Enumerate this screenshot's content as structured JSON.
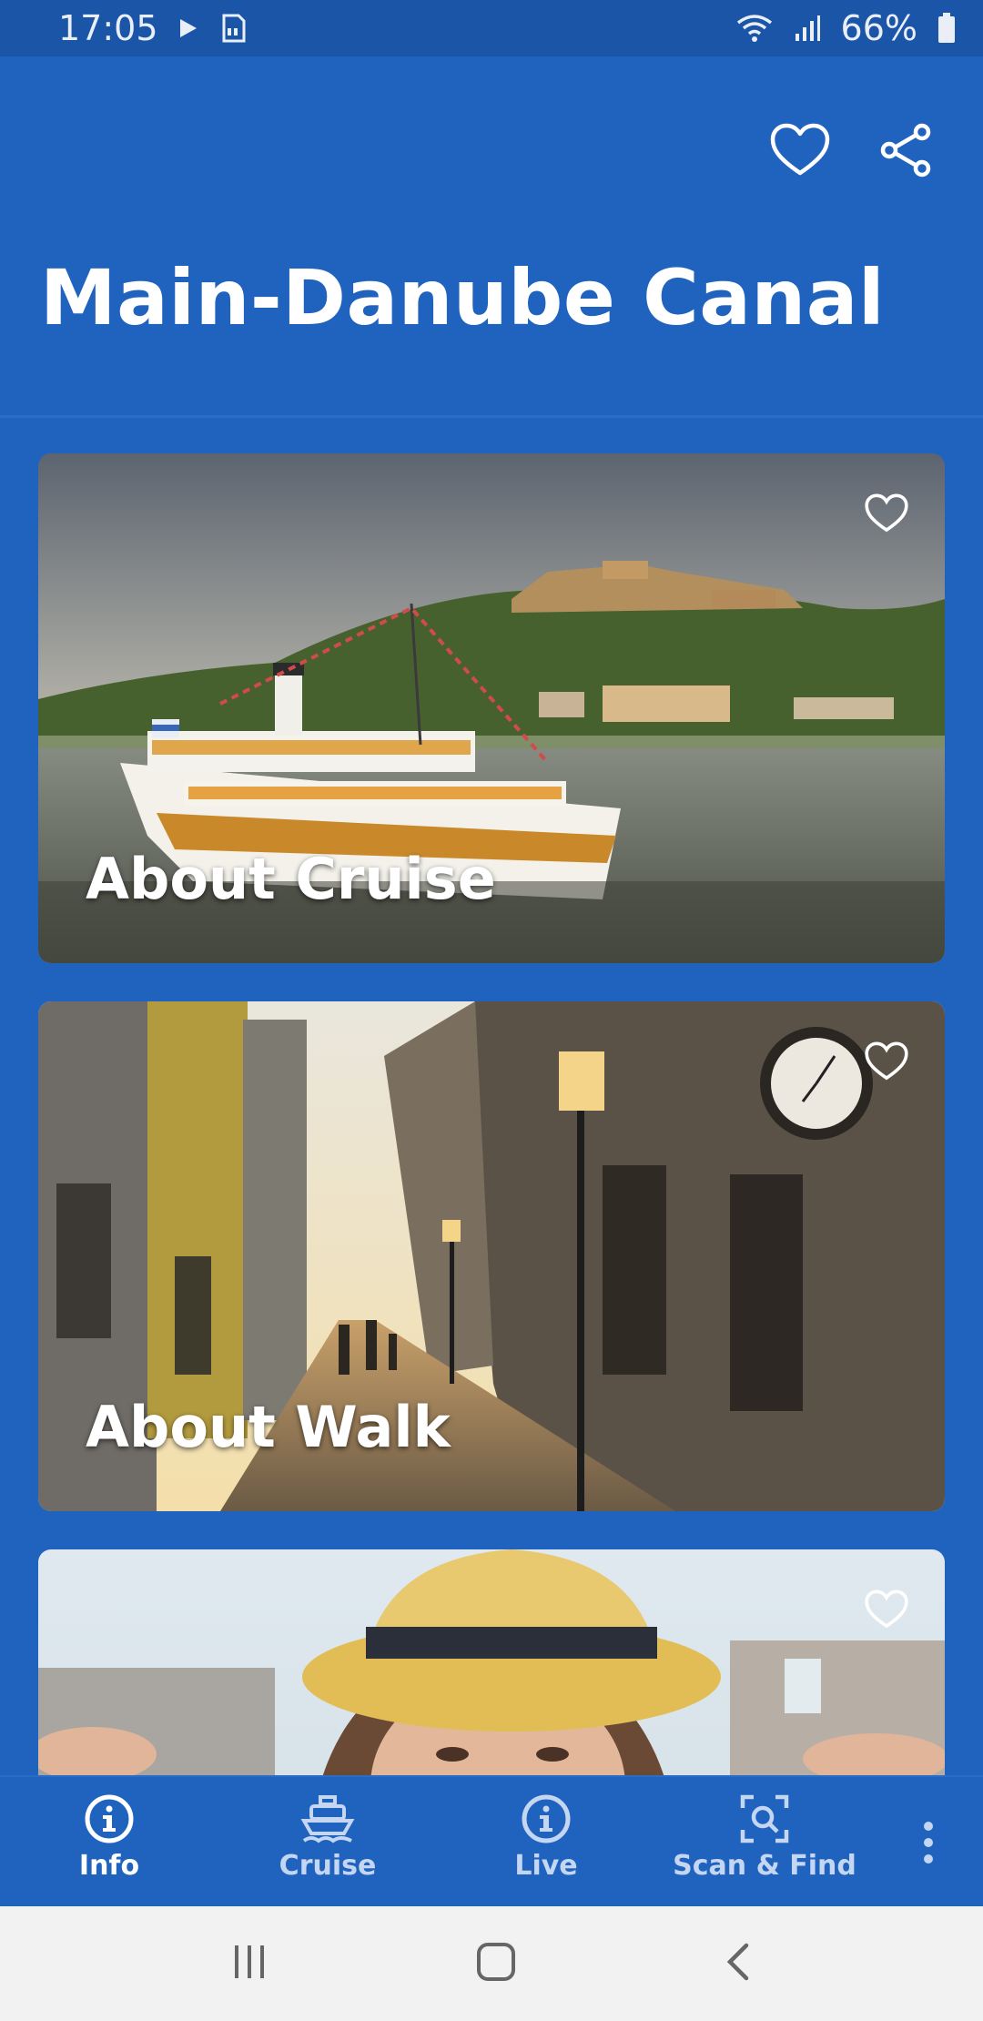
{
  "status_bar": {
    "time": "17:05",
    "battery": "66%",
    "icons": [
      "play-icon",
      "sd-card-icon",
      "wifi-icon",
      "signal-icon",
      "battery-icon"
    ]
  },
  "app_bar": {
    "title": "Main-Danube Canal",
    "actions": [
      "heart-outline-icon",
      "share-icon"
    ]
  },
  "cards": [
    {
      "title": "About Cruise",
      "image": "river-cruise-ship-and-castle"
    },
    {
      "title": "About Walk",
      "image": "old-town-street-at-sunset"
    },
    {
      "title": "",
      "image": "woman-in-straw-hat"
    }
  ],
  "bottom_nav": {
    "items": [
      {
        "label": "Info",
        "icon": "info-icon",
        "active": true
      },
      {
        "label": "Cruise",
        "icon": "ship-icon",
        "active": false
      },
      {
        "label": "Live",
        "icon": "info-icon",
        "active": false
      },
      {
        "label": "Scan & Find",
        "icon": "scan-search-icon",
        "active": false
      }
    ],
    "more_icon": "more-vertical-icon"
  },
  "system_nav": [
    "recents-icon",
    "home-icon",
    "back-icon"
  ],
  "colors": {
    "primary": "#1f63bf",
    "status_bar": "#1a55a8",
    "text": "#ffffff",
    "system_nav_bg": "#f2f2f2"
  }
}
